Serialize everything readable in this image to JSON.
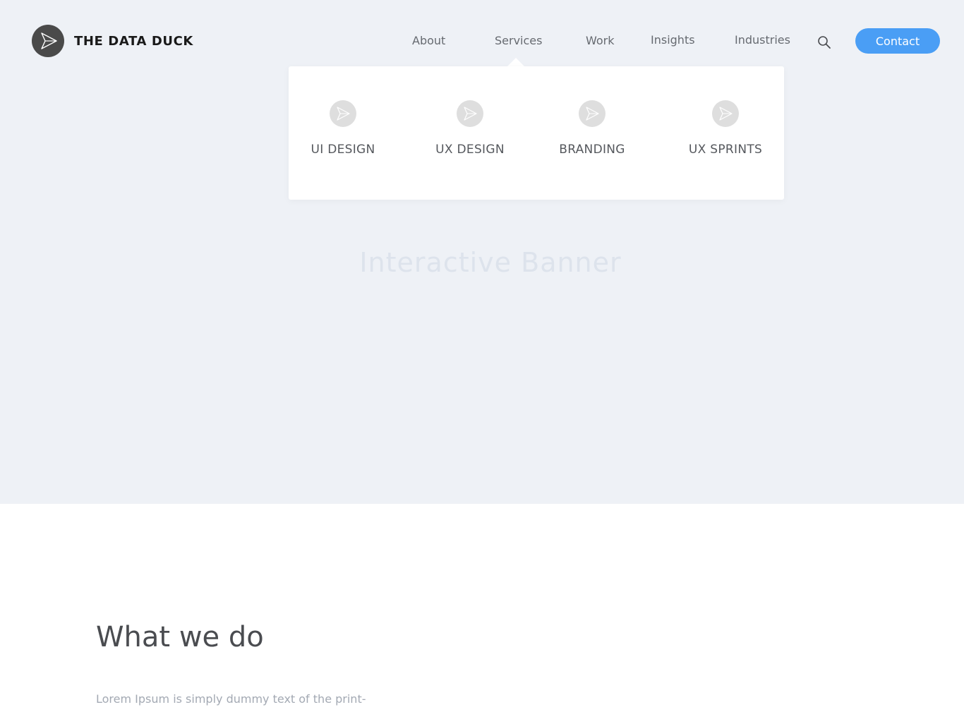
{
  "header": {
    "brand": "THE DATA DUCK",
    "nav": {
      "about": "About",
      "services": "Services",
      "work": "Work",
      "insights": "Insights",
      "industries": "Industries"
    },
    "contact_label": "Contact",
    "accent_color": "#4a9ef5"
  },
  "services_menu": {
    "items": [
      {
        "label": "UI DESIGN",
        "icon": "paper-plane-icon"
      },
      {
        "label": "UX DESIGN",
        "icon": "paper-plane-icon"
      },
      {
        "label": "BRANDING",
        "icon": "paper-plane-icon"
      },
      {
        "label": "UX SPRINTS",
        "icon": "paper-plane-icon"
      }
    ]
  },
  "hero": {
    "banner_title": "Interactive Banner"
  },
  "what_we_do": {
    "title": "What we do",
    "text": "Lorem Ipsum is simply dummy text of the print-"
  }
}
